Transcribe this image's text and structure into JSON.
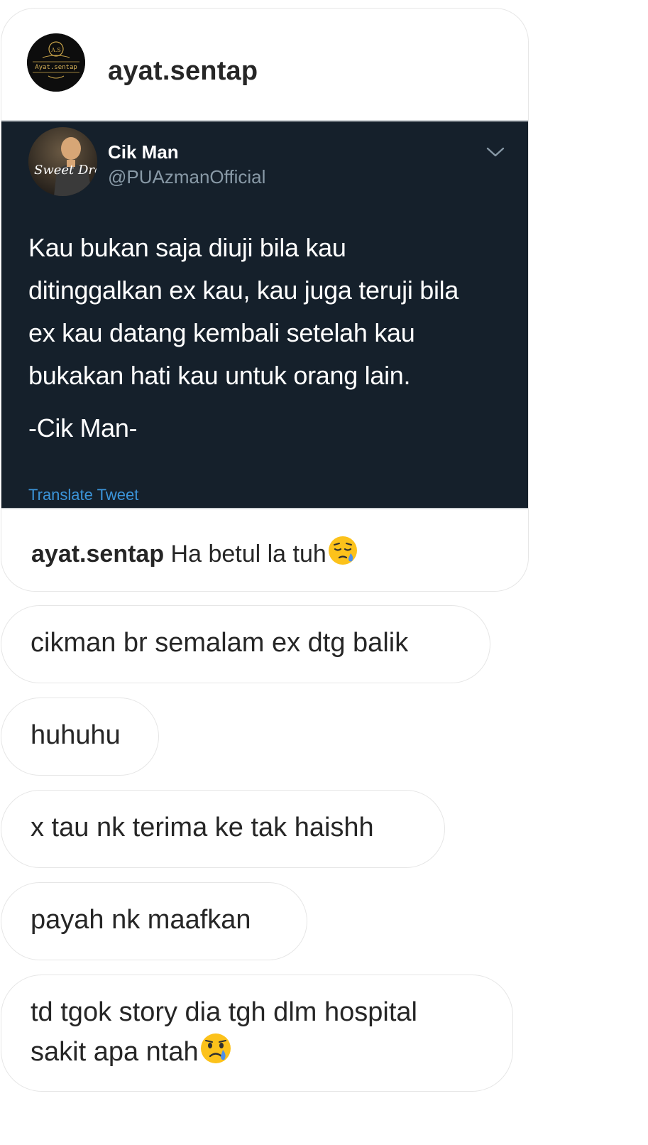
{
  "post": {
    "username": "ayat.sentap",
    "avatar_text": "Ayat.sentap",
    "avatar_monogram": "A.S",
    "tweet": {
      "name": "Cik Man",
      "handle": "@PUAzmanOfficial",
      "avatar_text": "Sweet Dreams",
      "text": "Kau bukan saja diuji bila kau\nditinggalkan ex kau, kau juga teruji bila\nex kau datang kembali setelah kau\nbukakan hati kau untuk orang lain.",
      "signature": "-Cik Man-",
      "translate_label": "Translate Tweet",
      "menu_icon": "chevron-down-icon"
    },
    "caption_user": "ayat.sentap",
    "caption_text": "Ha betul la tuh",
    "caption_emoji": "sleepy-face-emoji"
  },
  "messages": [
    {
      "text": "cikman br semalam ex dtg balik"
    },
    {
      "text": "huhuhu"
    },
    {
      "text": "x tau nk terima ke tak haishh"
    },
    {
      "text": "payah nk maafkan"
    },
    {
      "line1": "td tgok story dia tgh dlm hospital",
      "line2": "sakit apa ntah",
      "emoji": "crying-face-emoji"
    }
  ],
  "colors": {
    "tweet_bg": "#15202b",
    "tweet_secondary": "#8899a6",
    "link_blue": "#3b94d9",
    "bubble_border": "#e6e6e6",
    "text": "#262626"
  }
}
